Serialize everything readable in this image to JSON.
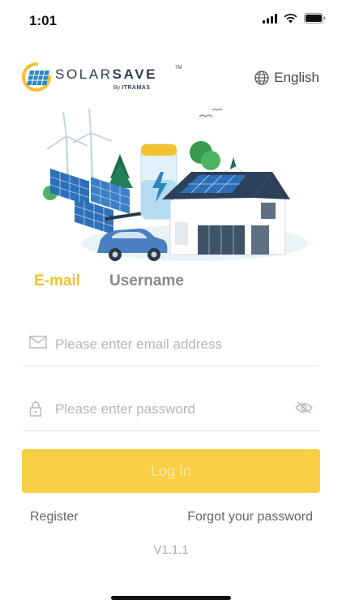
{
  "status_bar": {
    "time": "1:01"
  },
  "brand": {
    "name_light": "SOLAR",
    "name_bold": "SAVE",
    "tm": "TM",
    "by": "By",
    "company": "ITRAMAS"
  },
  "language": {
    "label": "English"
  },
  "tabs": [
    {
      "label": "E-mail",
      "active": true
    },
    {
      "label": "Username",
      "active": false
    }
  ],
  "form": {
    "email_placeholder": "Please enter email address",
    "password_placeholder": "Please enter password",
    "login_label": "Log In"
  },
  "links": {
    "register": "Register",
    "forgot": "Forgot your password"
  },
  "version": "V1.1.1",
  "colors": {
    "accent": "#f7d046",
    "accent_text": "#f2c230",
    "navy": "#2d3e57"
  }
}
